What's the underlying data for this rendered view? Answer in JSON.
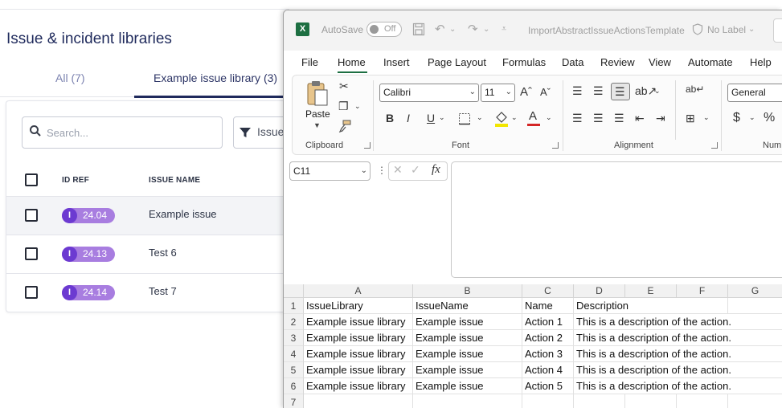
{
  "app": {
    "page_title": "Issue & incident libraries",
    "tabs": [
      {
        "label": "All (7)"
      },
      {
        "label": "Example issue library (3)"
      }
    ],
    "search_placeholder": "Search...",
    "filter_label": "Issue",
    "columns": [
      "ID REF",
      "ISSUE NAME"
    ],
    "badge_letter": "I",
    "rows": [
      {
        "id": "24.04",
        "name": "Example issue",
        "selected": true
      },
      {
        "id": "24.13",
        "name": "Test 6",
        "selected": false
      },
      {
        "id": "24.14",
        "name": "Test 7",
        "selected": false
      }
    ],
    "colors": {
      "title": "#1f2a5c",
      "badge_dark": "#6c3ad1",
      "badge_light": "#a87de0"
    }
  },
  "excel": {
    "autosave_label": "AutoSave",
    "autosave_state": "Off",
    "doc_title": "ImportAbstractIssueActionsTemplate",
    "sensitivity_label": "No Label",
    "menu": [
      "File",
      "Home",
      "Insert",
      "Page Layout",
      "Formulas",
      "Data",
      "Review",
      "View",
      "Automate",
      "Help"
    ],
    "active_menu": "Home",
    "ribbon": {
      "paste_label": "Paste",
      "clipboard_label": "Clipboard",
      "font_name": "Calibri",
      "font_size": "11",
      "font_label": "Font",
      "alignment_label": "Alignment",
      "number_format": "General",
      "number_label": "Num",
      "bold": "B",
      "italic": "I",
      "underline": "U",
      "currency": "$",
      "percent": "%"
    },
    "name_box": "C11",
    "fx_label": "fx",
    "grid": {
      "columns": [
        "A",
        "B",
        "C",
        "D",
        "E",
        "F",
        "G"
      ],
      "row_numbers": [
        "1",
        "2",
        "3",
        "4",
        "5",
        "6",
        "7"
      ],
      "rows": [
        [
          "IssueLibrary",
          "IssueName",
          "Name",
          "Description"
        ],
        [
          "Example issue library",
          "Example issue",
          "Action 1",
          "This is a description of the action."
        ],
        [
          "Example issue library",
          "Example issue",
          "Action 2",
          "This is a description of the action."
        ],
        [
          "Example issue library",
          "Example issue",
          "Action 3",
          "This is a description of the action."
        ],
        [
          "Example issue library",
          "Example issue",
          "Action 4",
          "This is a description of the action."
        ],
        [
          "Example issue library",
          "Example issue",
          "Action 5",
          "This is a description of the action."
        ],
        [
          "",
          "",
          "",
          ""
        ]
      ]
    },
    "colors": {
      "brand": "#1d6f42"
    }
  }
}
